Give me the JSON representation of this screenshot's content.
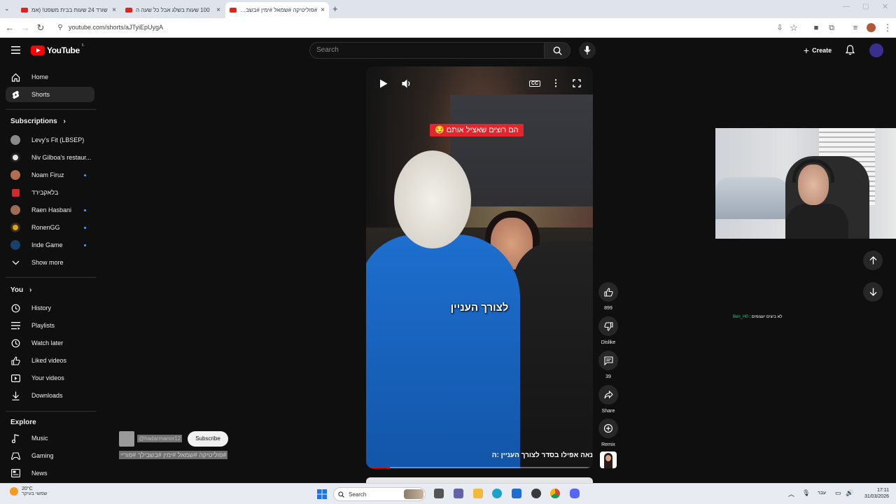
{
  "browser": {
    "tabs": [
      {
        "title": "שורד 24 שעות בבית משפט! (אמ"
      },
      {
        "title": "100 שעות בשלג אבל כל שעה ה"
      },
      {
        "title": "#פוליטיקה #שמאל #ימין #בשבילך #"
      }
    ],
    "url": "youtube.com/shorts/aJTyiEpUygA"
  },
  "header": {
    "logo_text": "YouTube",
    "country_code": "IL",
    "search_placeholder": "Search",
    "create_label": "Create"
  },
  "sidebar": {
    "main": [
      {
        "label": "Home",
        "icon": "home-icon"
      },
      {
        "label": "Shorts",
        "icon": "shorts-icon",
        "active": true
      }
    ],
    "subscriptions_heading": "Subscriptions",
    "subscriptions": [
      {
        "label": "Levy's Fit (LBSEP)",
        "color": "#8a8a8a",
        "dot": false
      },
      {
        "label": "Niv Gilboa's restaur...",
        "color": "#e8e8e8",
        "dot": false
      },
      {
        "label": "Noam Firuz",
        "color": "#b07050",
        "dot": true
      },
      {
        "label": "בלאקבירד",
        "color": "#d12a2a",
        "dot": false
      },
      {
        "label": "Raen Hasbani",
        "color": "#a06a55",
        "dot": true
      },
      {
        "label": "RonenGG",
        "color": "#d9a520",
        "dot": true
      },
      {
        "label": "Inde Game",
        "color": "#1b3f6b",
        "dot": true
      }
    ],
    "show_more": "Show more",
    "you_heading": "You",
    "you": [
      {
        "label": "History",
        "icon": "history-icon"
      },
      {
        "label": "Playlists",
        "icon": "playlists-icon"
      },
      {
        "label": "Watch later",
        "icon": "watch-later-icon"
      },
      {
        "label": "Liked videos",
        "icon": "liked-videos-icon"
      },
      {
        "label": "Your videos",
        "icon": "your-videos-icon"
      },
      {
        "label": "Downloads",
        "icon": "downloads-icon"
      }
    ],
    "explore_heading": "Explore",
    "explore": [
      {
        "label": "Music",
        "icon": "music-icon"
      },
      {
        "label": "Gaming",
        "icon": "gaming-icon"
      },
      {
        "label": "News",
        "icon": "news-icon"
      }
    ]
  },
  "video": {
    "top_label": "הם רוצים שאציל אותם 😏",
    "subtitle": "לצורך העניין",
    "bottom_title": "נאה אפילו בסדר לצורך העניין :ה",
    "progress": 0.1
  },
  "actions": {
    "likes": "899",
    "dislike": "Dislike",
    "comments": "39",
    "share": "Share",
    "remix": "Remix"
  },
  "channel": {
    "handle": "@hadarmanor12",
    "subscribe": "Subscribe",
    "tags": "#פוליטיקה #שמאל #ימין #בשבילך #פוריי"
  },
  "chat": {
    "user": "Ben_H0",
    "message": ": לא ביצים יעצומים"
  },
  "taskbar": {
    "temperature": "20°C",
    "weather_text": "שמשי בעיקר",
    "search_label": "Search",
    "language": "עבר",
    "time": "17:11",
    "date": "31/03/2026"
  }
}
